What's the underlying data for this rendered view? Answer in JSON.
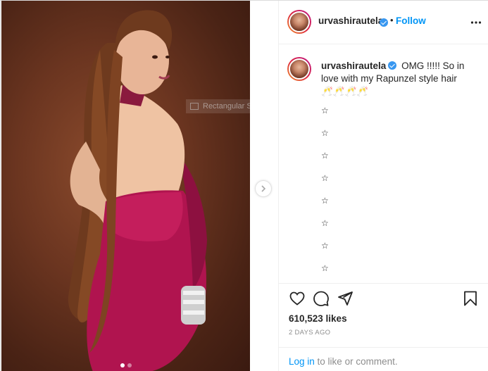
{
  "post": {
    "author": {
      "username": "urvashirautela",
      "verified": true
    },
    "header": {
      "separator": "•",
      "follow_label": "Follow",
      "more_icon": "more-dots-icon"
    },
    "caption": {
      "username": "urvashirautela",
      "text": "OMG !!!!! So in love with my Rapunzel style hair 🥂🥂🥂🥂",
      "stars": [
        "☆",
        "☆",
        "☆",
        "☆",
        "☆",
        "☆",
        "☆",
        "☆"
      ]
    },
    "overlay": {
      "label": "Rectangular Snip"
    },
    "carousel": {
      "slide_count": 2,
      "active_index": 0,
      "next_icon": "chevron-right-icon"
    },
    "actions": {
      "like_icon": "heart-icon",
      "comment_icon": "comment-icon",
      "share_icon": "share-icon",
      "save_icon": "bookmark-icon"
    },
    "stats": {
      "likes": "610,523 likes",
      "time_ago": "2 DAYS AGO"
    },
    "footer": {
      "login_link": "Log in",
      "login_suffix": " to like or comment."
    },
    "colors": {
      "accent": "#0095f6",
      "verified": "#3897f0",
      "background": "#ab3a2b",
      "dress": "#b0144f"
    }
  }
}
